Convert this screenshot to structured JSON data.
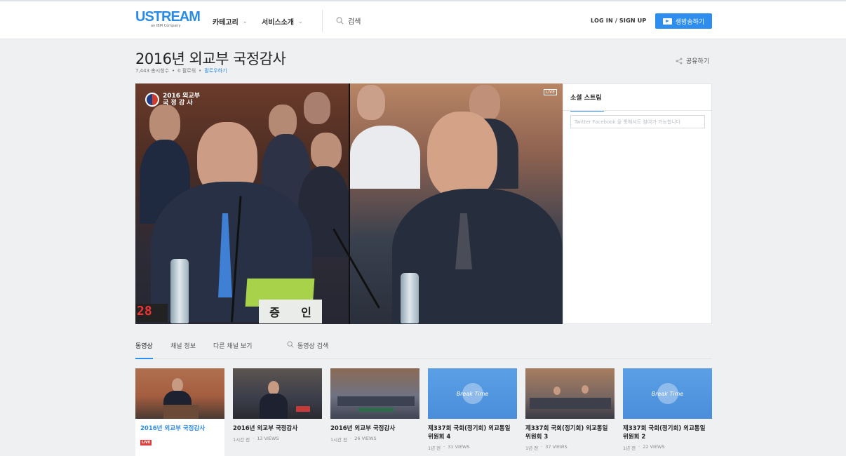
{
  "header": {
    "logo_text": "USTREAM",
    "logo_sub": "an IBM Company",
    "nav": [
      {
        "label": "카테고리"
      },
      {
        "label": "서비스소개"
      }
    ],
    "search_label": "검색",
    "login_label": "LOG IN / SIGN UP",
    "broadcast_label": "생방송하기"
  },
  "channel": {
    "title": "2016년 외교부 국정감사",
    "views_total": "7,443 총시청수",
    "followers": "0 팔로워",
    "follow_label": "팔로우하기",
    "share_label": "공유하기"
  },
  "video": {
    "badge_line1": "2016 외교부",
    "badge_line2": "국 정 감 사",
    "live_label": "LIVE",
    "counter": "28",
    "nameplate": [
      "증",
      "인"
    ]
  },
  "social": {
    "tab_label": "소셜 스트림",
    "placeholder": "Twitter Facebook 을 통해서도 참여가 가능합니다"
  },
  "tabs": {
    "videos": "동영상",
    "channel_info": "채널 정보",
    "other_channels": "다른 채널 보기",
    "video_search": "동영상 검색"
  },
  "thumbnails": [
    {
      "title": "2016년 외교부 국정감사",
      "live": "LIVE",
      "time": "",
      "views": ""
    },
    {
      "title": "2016년 외교부 국정감사",
      "time": "1시간 전",
      "views": "13 VIEWS"
    },
    {
      "title": "2016년 외교부 국정감사",
      "time": "1시간 전",
      "views": "26 VIEWS"
    },
    {
      "title": "제337회 국회(정기회) 외교통일위원회 4",
      "time": "1년 전",
      "views": "31 VIEWS",
      "overlay": "Break Time"
    },
    {
      "title": "제337회 국회(정기회) 외교통일위원회 3",
      "time": "1년 전",
      "views": "37 VIEWS"
    },
    {
      "title": "제337회 국회(정기회) 외교통일위원회 2",
      "time": "1년 전",
      "views": "22 VIEWS",
      "overlay": "Break Time"
    }
  ],
  "colors": {
    "accent": "#2d8ef0",
    "live": "#e23b3b"
  }
}
